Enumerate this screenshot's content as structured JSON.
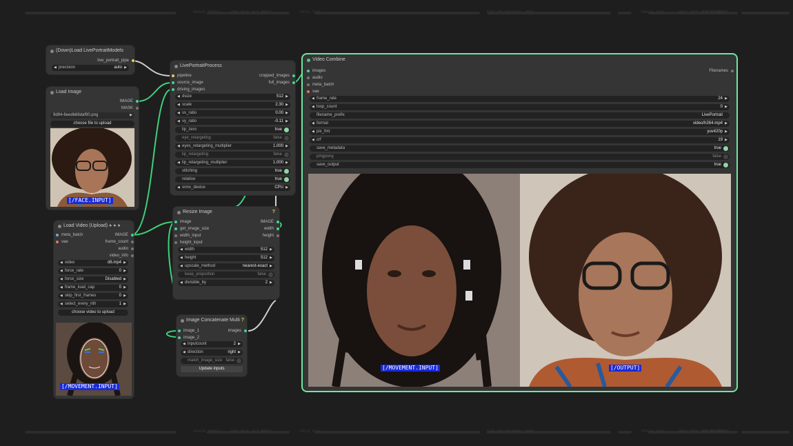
{
  "bars": {
    "top": [
      "IMAGE_INPUT",
      "IMG_MSK_ALT_BBOX",
      "FACE_FILE",
      "CUT_PR_ORIGNAL_MAP",
      "IMAGE_LIST",
      "MSK_DPH_ALT_PROCESS",
      "FACE_INFO"
    ],
    "bottom": [
      "IMAGE_INPUT",
      "IMG_MSK_ALT_BBOX",
      "FACE_FILE",
      "CUT_PR_ORIGNAL_MAP",
      "IMAGE_LIST",
      "MSK_DPH_ALT_PROCESS",
      "FACE_INFO"
    ]
  },
  "models": {
    "title": "(Down)Load LivePortraitModels",
    "out": "live_portrait_pipe",
    "precision_label": "precision",
    "precision_value": "auto"
  },
  "load_image": {
    "title": "Load Image",
    "out_image": "IMAGE",
    "out_mask": "MASK",
    "file": "9d94-6eedb68daf90.png",
    "upload": "choose file to upload",
    "tag": "[/FACE.INPUT]"
  },
  "load_video": {
    "title": "Load Video (Upload)",
    "icons": "● ● ●",
    "in_meta": "meta_batch",
    "in_vae": "vae",
    "outs": [
      "IMAGE",
      "frame_count",
      "audio",
      "video_info"
    ],
    "widgets": [
      [
        "video",
        "d6.mp4"
      ],
      [
        "force_rate",
        "0"
      ],
      [
        "force_size",
        "Disabled"
      ],
      [
        "frame_load_cap",
        "0"
      ],
      [
        "skip_first_frames",
        "0"
      ],
      [
        "select_every_nth",
        "1"
      ]
    ],
    "upload": "choose video to upload",
    "tag": "[/MOVEMENT.INPUT]"
  },
  "lpp": {
    "title": "LivePortraitProcess",
    "ins": [
      "pipeline",
      "source_image",
      "driving_images"
    ],
    "outs": [
      "cropped_images",
      "full_images"
    ],
    "widgets": [
      [
        "dsize",
        "512"
      ],
      [
        "scale",
        "2.30"
      ],
      [
        "vx_ratio",
        "0.00"
      ],
      [
        "vy_ratio",
        "-0.11"
      ]
    ],
    "toggles": [
      [
        "lip_zero",
        "true",
        true
      ],
      [
        "eye_retargeting",
        "false",
        false
      ],
      [
        "eyes_retargeting_multiplier",
        "1.000",
        null
      ],
      [
        "lip_retargeting",
        "false",
        false
      ],
      [
        "lip_retargeting_multiplier",
        "1.000",
        null
      ],
      [
        "stitching",
        "true",
        true
      ],
      [
        "relative",
        "true",
        true
      ],
      [
        "onnx_device",
        "CPU",
        null
      ]
    ]
  },
  "resize": {
    "title": "Resize Image",
    "q": "?",
    "ins": [
      "image",
      "get_image_size",
      "width_input",
      "height_input"
    ],
    "outs": [
      "IMAGE",
      "width",
      "height"
    ],
    "widgets": [
      [
        "width",
        "512"
      ],
      [
        "height",
        "512"
      ],
      [
        "upscale_method",
        "nearest-exact"
      ]
    ],
    "keep": [
      "keep_proportion",
      "false"
    ],
    "div": [
      "divisible_by",
      "2"
    ]
  },
  "concat": {
    "title": "Image Concatenate Multi",
    "q": "?",
    "ins": [
      "image_1",
      "image_2"
    ],
    "out": "images",
    "widgets": [
      [
        "inputcount",
        "2"
      ],
      [
        "direction",
        "right"
      ]
    ],
    "match": [
      "match_image_size",
      "false"
    ],
    "btn": "Update inputs"
  },
  "video": {
    "title": "Video Combine",
    "ins": [
      "images",
      "audio",
      "meta_batch",
      "vae"
    ],
    "out": "Filenames",
    "widgets": [
      [
        "frame_rate",
        "24",
        "a"
      ],
      [
        "loop_count",
        "0",
        "a"
      ],
      [
        "filename_prefix",
        "LivePortrait",
        "s"
      ],
      [
        "format",
        "video/h264-mp4",
        "a"
      ],
      [
        "pix_fmt",
        "yuv420p",
        "a"
      ],
      [
        "crf",
        "19",
        "a"
      ],
      [
        "save_metadata",
        "true",
        "t"
      ],
      [
        "pingpong",
        "false",
        "f"
      ],
      [
        "save_output",
        "true",
        "t"
      ]
    ],
    "tag_left": "[/MOVEMENT.INPUT]",
    "tag_right": "[/OUTPUT]"
  }
}
